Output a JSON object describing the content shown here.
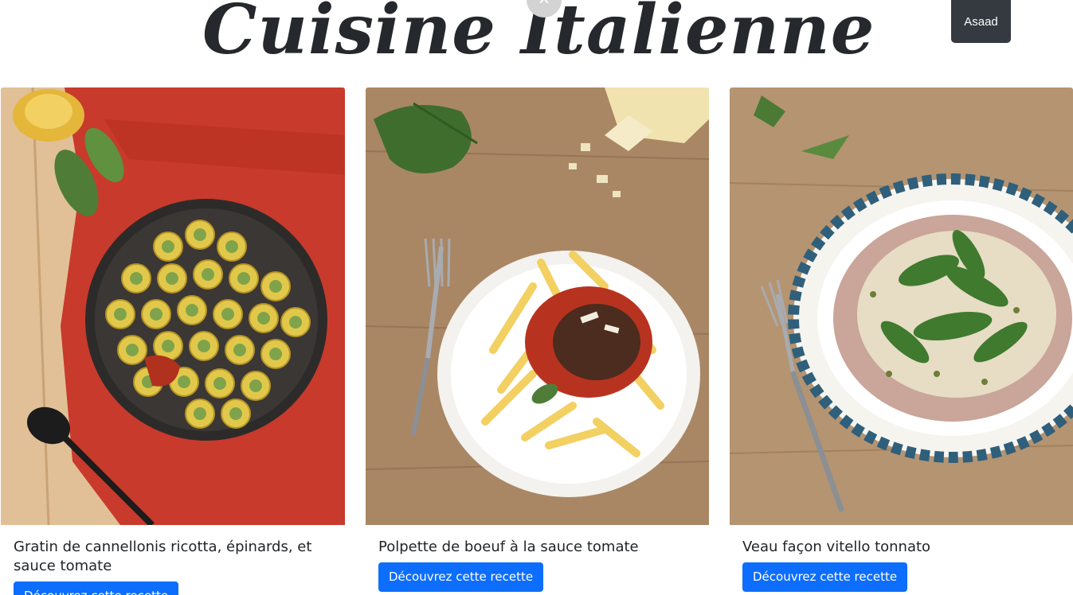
{
  "header": {
    "title": "Cuisine Italienne",
    "close_symbol": "×",
    "user_label": "Asaad"
  },
  "recipes": [
    {
      "title": "Gratin de cannellonis ricotta, épinards, et sauce tomate",
      "button": "Découvrez cette recette"
    },
    {
      "title": "Polpette de boeuf à la sauce tomate",
      "button": "Découvrez cette recette"
    },
    {
      "title": "Veau façon vitello tonnato",
      "button": "Découvrez cette recette"
    }
  ],
  "colors": {
    "title": "#25282d",
    "user_button": "#343a40",
    "primary": "#0d6efd"
  }
}
